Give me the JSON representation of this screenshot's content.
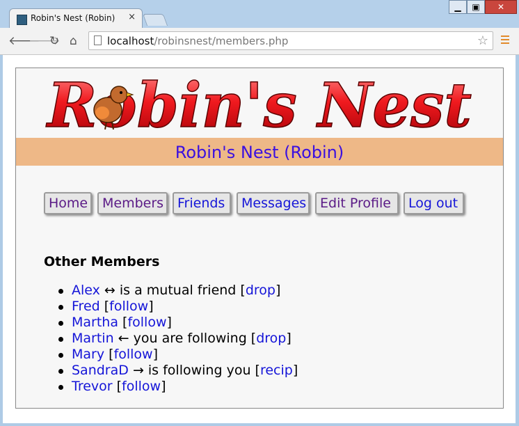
{
  "browser": {
    "tab_title": "Robin's Nest (Robin)",
    "tab_close": "×",
    "url_host": "localhost",
    "url_path": "/robinsnest/members.php",
    "minimize": "▁",
    "maximize": "▣",
    "close": "✕"
  },
  "site": {
    "logo_text": "Robin's Nest",
    "subtitle": "Robin's Nest (Robin)",
    "menu": [
      "Home",
      "Members",
      "Friends",
      "Messages",
      "Edit Profile",
      "Log out"
    ]
  },
  "members": {
    "heading": "Other Members",
    "items": [
      {
        "name": "Alex",
        "status": " ↔ is a mutual friend ",
        "action": "drop"
      },
      {
        "name": "Fred",
        "status": " ",
        "action": "follow"
      },
      {
        "name": "Martha",
        "status": " ",
        "action": "follow"
      },
      {
        "name": "Martin",
        "status": " ← you are following ",
        "action": "drop"
      },
      {
        "name": "Mary",
        "status": " ",
        "action": "follow"
      },
      {
        "name": "SandraD",
        "status": " → is following you ",
        "action": "recip"
      },
      {
        "name": "Trevor",
        "status": " ",
        "action": "follow"
      }
    ]
  },
  "colors": {
    "subtitle_band": "#eeb887",
    "subtitle_text": "#3b10e0",
    "logo_red": "#e8161c",
    "link": "#1515d8",
    "visited": "#5a1a86"
  }
}
